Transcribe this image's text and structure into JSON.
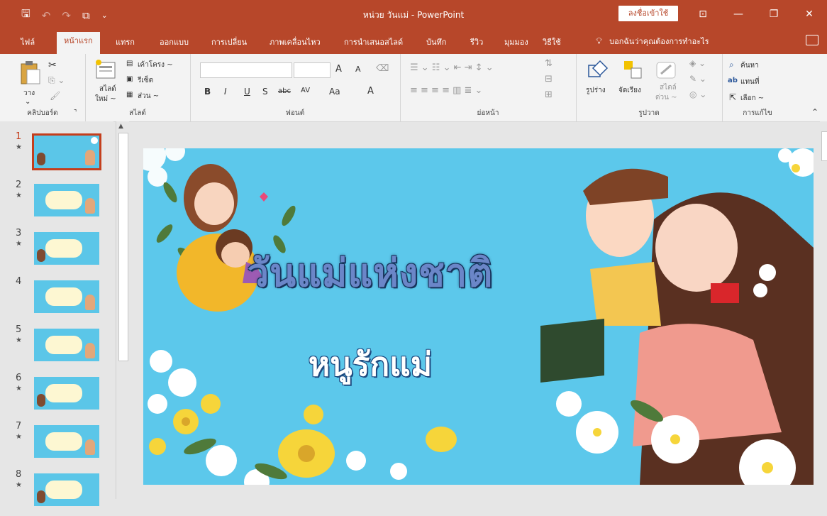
{
  "window": {
    "title": "หน่วย วันแม่  -  PowerPoint",
    "signin": "ลงชื่อเข้าใช้"
  },
  "tabs": [
    "ไฟล์",
    "หน้าแรก",
    "แทรก",
    "ออกแบบ",
    "การเปลี่ยน",
    "ภาพเคลื่อนไหว",
    "การนำเสนอสไลด์",
    "บันทึก",
    "รีวิว",
    "มุมมอง",
    "วิธีใช้"
  ],
  "tell_me": "บอกฉันว่าคุณต้องการทำอะไร",
  "ribbon": {
    "clipboard": {
      "paste": "วาง",
      "label": "คลิปบอร์ด"
    },
    "slides": {
      "new_slide_1": "สไลด์",
      "new_slide_2": "ใหม่ ~",
      "layout": "เค้าโครง ~",
      "reset": "รีเซ็ต",
      "section": "ส่วน ~",
      "label": "สไลด์"
    },
    "font": {
      "bold": "B",
      "italic": "I",
      "underline": "U",
      "shadow": "S",
      "strike": "abc",
      "spacing": "AV",
      "case": "Aa",
      "color": "A",
      "grow": "A",
      "shrink": "A",
      "label": "ฟอนต์"
    },
    "paragraph": {
      "label": "ย่อหน้า"
    },
    "drawing": {
      "shapes": "รูปร่าง",
      "arrange": "จัดเรียง",
      "styles_1": "สไตล์",
      "styles_2": "ด่วน ~",
      "label": "รูปวาด"
    },
    "editing": {
      "find": "ค้นหา",
      "replace": "แทนที่",
      "select": "เลือก ~",
      "label": "การแก้ไข"
    }
  },
  "thumbnails": [
    {
      "num": "1",
      "star": "★"
    },
    {
      "num": "2",
      "star": "★"
    },
    {
      "num": "3",
      "star": "★"
    },
    {
      "num": "4",
      "star": ""
    },
    {
      "num": "5",
      "star": "★"
    },
    {
      "num": "6",
      "star": "★"
    },
    {
      "num": "7",
      "star": "★"
    },
    {
      "num": "8",
      "star": "★"
    }
  ],
  "slide": {
    "title": "วันแม่แห่งชาติ",
    "subtitle": "หนูรักแม่"
  }
}
